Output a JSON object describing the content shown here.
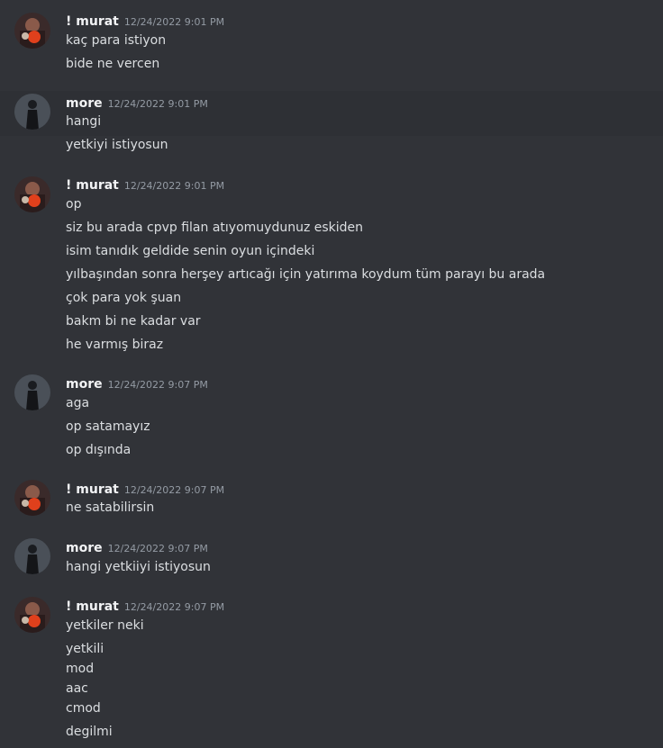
{
  "users": {
    "murat": {
      "name": "! murat",
      "avatar_icon": "user-avatar-red-icon"
    },
    "more": {
      "name": "more",
      "avatar_icon": "user-avatar-dark-figure-icon"
    }
  },
  "colors": {
    "background": "#313338",
    "hover_background": "#2e3035",
    "username": "#f2f3f5",
    "message_text": "#dbdee1",
    "timestamp": "#949ba4"
  },
  "messages": [
    {
      "user": "! murat",
      "timestamp": "12/24/2022 9:01 PM",
      "lines": [
        "kaç para istiyon",
        "bide ne vercen"
      ]
    },
    {
      "user": "more",
      "timestamp": "12/24/2022 9:01 PM",
      "lines": [
        "hangi",
        "yetkiyi istiyosun"
      ]
    },
    {
      "user": "! murat",
      "timestamp": "12/24/2022 9:01 PM",
      "lines": [
        "op",
        "siz bu arada cpvp filan atıyomuydunuz eskiden",
        "isim tanıdık geldide senin oyun içindeki",
        "yılbaşından sonra herşey artıcağı için yatırıma koydum tüm parayı bu arada",
        "çok para yok şuan",
        "bakm bi ne kadar var",
        "he varmış biraz"
      ]
    },
    {
      "user": "more",
      "timestamp": "12/24/2022 9:07 PM",
      "lines": [
        "aga",
        "op satamayız",
        "op dışında"
      ]
    },
    {
      "user": "! murat",
      "timestamp": "12/24/2022 9:07 PM",
      "lines": [
        "ne satabilirsin"
      ]
    },
    {
      "user": "more",
      "timestamp": "12/24/2022 9:07 PM",
      "lines": [
        "hangi yetkiiyi istiyosun"
      ]
    },
    {
      "user": "! murat",
      "timestamp": "12/24/2022 9:07 PM",
      "lines": [
        "yetkiler neki",
        "yetkili",
        "mod",
        "aac",
        "cmod",
        "degilmi"
      ]
    }
  ]
}
